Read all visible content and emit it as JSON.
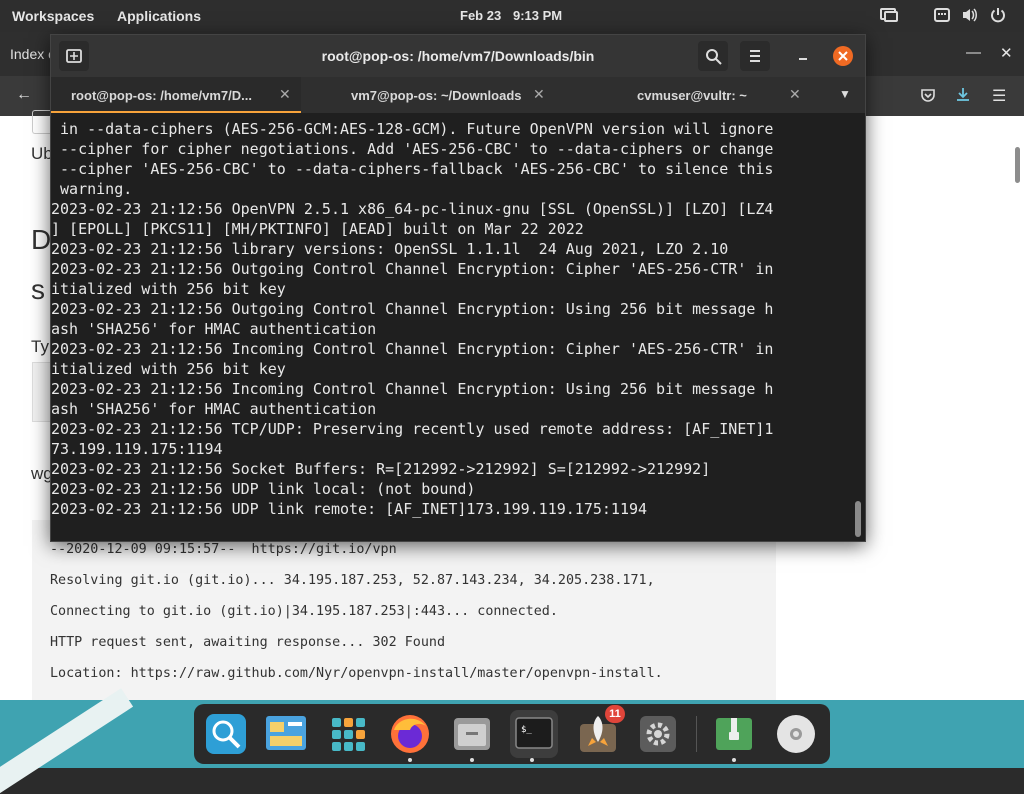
{
  "topbar": {
    "workspaces": "Workspaces",
    "applications": "Applications",
    "date": "Feb 23",
    "time": "9:13 PM"
  },
  "browser": {
    "tab_title": "Index o",
    "page_fragments": {
      "ub": "Ub",
      "d": "D",
      "s": "s",
      "ty": "Ty",
      "wg": "wg"
    },
    "code_lines": [
      "--2020-12-09 09:15:57--  https://git.io/vpn",
      "Resolving git.io (git.io)... 34.195.187.253, 52.87.143.234, 34.205.238.171,",
      "Connecting to git.io (git.io)|34.195.187.253|:443... connected.",
      "HTTP request sent, awaiting response... 302 Found",
      "Location: https://raw.github.com/Nyr/openvpn-install/master/openvpn-install."
    ]
  },
  "terminal": {
    "title": "root@pop-os: /home/vm7/Downloads/bin",
    "tabs": [
      {
        "label": "root@pop-os: /home/vm7/D..."
      },
      {
        "label": "vm7@pop-os: ~/Downloads"
      },
      {
        "label": "cvmuser@vultr: ~"
      }
    ],
    "lines": [
      " in --data-ciphers (AES-256-GCM:AES-128-GCM). Future OpenVPN version will ignore",
      " --cipher for cipher negotiations. Add 'AES-256-CBC' to --data-ciphers or change",
      " --cipher 'AES-256-CBC' to --data-ciphers-fallback 'AES-256-CBC' to silence this",
      " warning.",
      "2023-02-23 21:12:56 OpenVPN 2.5.1 x86_64-pc-linux-gnu [SSL (OpenSSL)] [LZO] [LZ4",
      "] [EPOLL] [PKCS11] [MH/PKTINFO] [AEAD] built on Mar 22 2022",
      "2023-02-23 21:12:56 library versions: OpenSSL 1.1.1l  24 Aug 2021, LZO 2.10",
      "2023-02-23 21:12:56 Outgoing Control Channel Encryption: Cipher 'AES-256-CTR' in",
      "itialized with 256 bit key",
      "2023-02-23 21:12:56 Outgoing Control Channel Encryption: Using 256 bit message h",
      "ash 'SHA256' for HMAC authentication",
      "2023-02-23 21:12:56 Incoming Control Channel Encryption: Cipher 'AES-256-CTR' in",
      "itialized with 256 bit key",
      "2023-02-23 21:12:56 Incoming Control Channel Encryption: Using 256 bit message h",
      "ash 'SHA256' for HMAC authentication",
      "2023-02-23 21:12:56 TCP/UDP: Preserving recently used remote address: [AF_INET]1",
      "73.199.119.175:1194",
      "2023-02-23 21:12:56 Socket Buffers: R=[212992->212992] S=[212992->212992]",
      "2023-02-23 21:12:56 UDP link local: (not bound)",
      "2023-02-23 21:12:56 UDP link remote: [AF_INET]173.199.119.175:1194"
    ]
  },
  "dock": {
    "notification_count": "11",
    "apps": [
      {
        "icon": "search-icon"
      },
      {
        "icon": "files-icon"
      },
      {
        "icon": "app-grid-icon"
      },
      {
        "icon": "firefox-icon"
      },
      {
        "icon": "file-manager-icon"
      },
      {
        "icon": "terminal-icon"
      },
      {
        "icon": "launcher-rocket-icon"
      },
      {
        "icon": "settings-icon"
      },
      {
        "icon": "archive-manager-icon"
      },
      {
        "icon": "disc-icon"
      }
    ]
  },
  "colors": {
    "accent": "#f7a33b",
    "close_button": "#f06a23",
    "dock_background": "#3fa3b1"
  }
}
